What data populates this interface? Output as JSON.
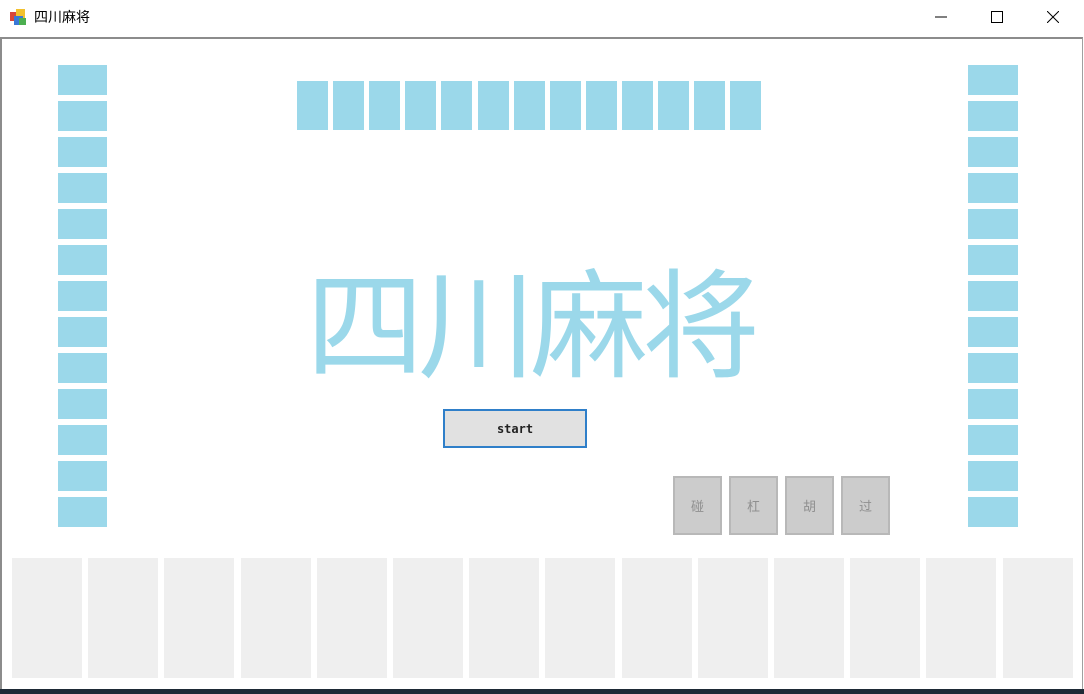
{
  "window": {
    "title": "四川麻将",
    "controls": {
      "minimize": "—",
      "maximize": "☐",
      "close": "✕"
    }
  },
  "game": {
    "title": "四川麻将",
    "start_label": "start",
    "actions": [
      "碰",
      "杠",
      "胡",
      "过"
    ]
  },
  "colors": {
    "tile_back": "#9bd8ea",
    "hand_slot": "#efefef",
    "action_disabled": "#cccccc",
    "start_border": "#2f7fc9"
  },
  "tiles": {
    "top_count": 13,
    "left_count": 13,
    "right_count": 13,
    "hand_count": 14
  }
}
